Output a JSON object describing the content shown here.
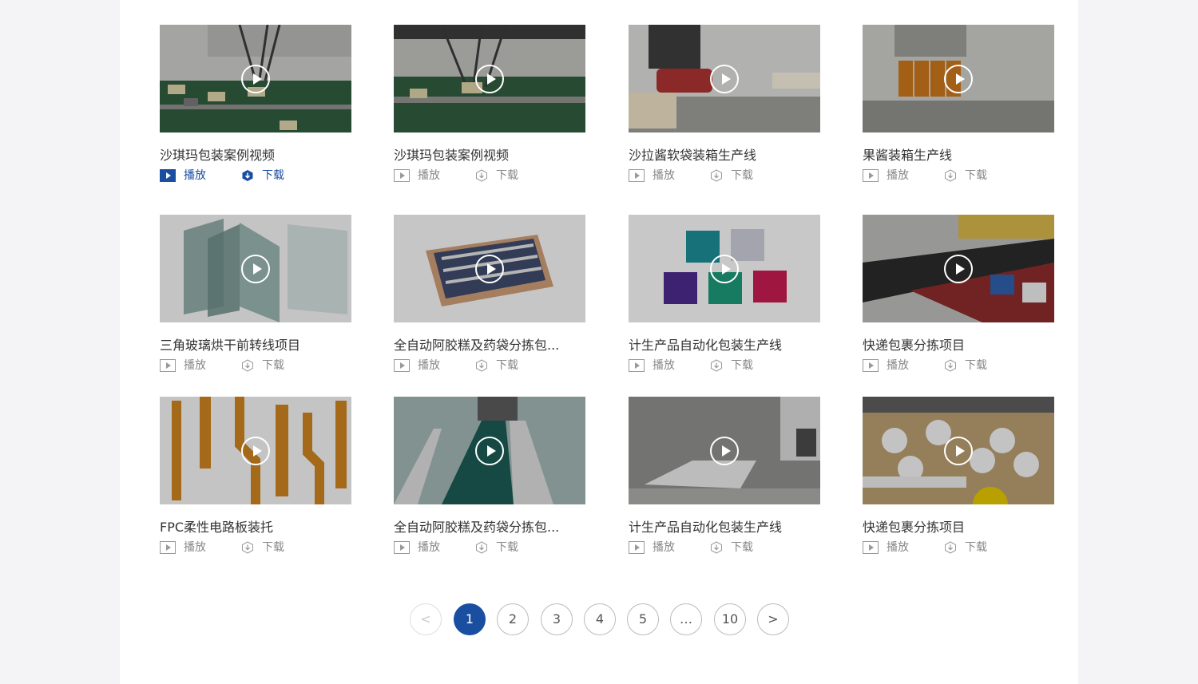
{
  "colors": {
    "accent": "#1a4ea1"
  },
  "videos": [
    {
      "title": "沙琪玛包装案例视频",
      "play": "播放",
      "download": "下载",
      "active": true
    },
    {
      "title": "沙琪玛包装案例视频",
      "play": "播放",
      "download": "下载"
    },
    {
      "title": "沙拉酱软袋装箱生产线",
      "play": "播放",
      "download": "下载"
    },
    {
      "title": "果酱装箱生产线",
      "play": "播放",
      "download": "下载"
    },
    {
      "title": "三角玻璃烘干前转线项目",
      "play": "播放",
      "download": "下载"
    },
    {
      "title": "全自动阿胶糕及药袋分拣包...",
      "play": "播放",
      "download": "下载"
    },
    {
      "title": "计生产品自动化包装生产线",
      "play": "播放",
      "download": "下载"
    },
    {
      "title": "快递包裹分拣项目",
      "play": "播放",
      "download": "下载"
    },
    {
      "title": "FPC柔性电路板装托",
      "play": "播放",
      "download": "下载"
    },
    {
      "title": "全自动阿胶糕及药袋分拣包...",
      "play": "播放",
      "download": "下载"
    },
    {
      "title": "计生产品自动化包装生产线",
      "play": "播放",
      "download": "下载"
    },
    {
      "title": "快递包裹分拣项目",
      "play": "播放",
      "download": "下载"
    }
  ],
  "pagination": {
    "prev": "<",
    "pages": [
      "1",
      "2",
      "3",
      "4",
      "5",
      "…",
      "10"
    ],
    "current": "1",
    "next": ">"
  }
}
